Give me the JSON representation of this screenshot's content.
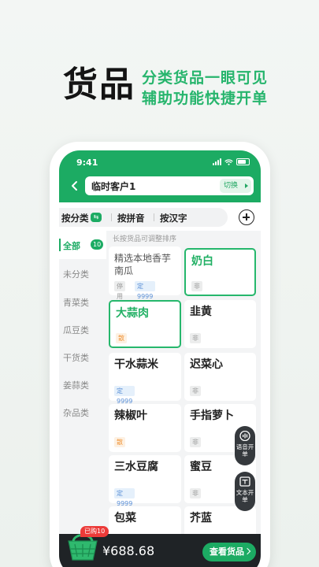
{
  "promo": {
    "title": "货品",
    "subtitle_1": "分类货品一眼可见",
    "subtitle_2": "辅助功能快捷开单",
    "accent": "#27b56d"
  },
  "status": {
    "time": "9:41"
  },
  "header": {
    "customer": "临时客户1",
    "switch_label": "切换",
    "brand": "#1cab63"
  },
  "sort": {
    "options": [
      "按分类",
      "按拼音",
      "按汉字"
    ],
    "swap_icon": "⇆"
  },
  "hint": "长按货品可调整排序",
  "categories": [
    {
      "label": "全部",
      "count": "10"
    },
    {
      "label": "未分类"
    },
    {
      "label": "青菜类"
    },
    {
      "label": "瓜豆类"
    },
    {
      "label": "干货类"
    },
    {
      "label": "姜蒜类"
    },
    {
      "label": "杂品类"
    }
  ],
  "products": [
    {
      "name": "精选本地香芋南瓜",
      "tags": [
        "停用",
        "定9999"
      ]
    },
    {
      "name": "奶白",
      "tags": [
        "非"
      ]
    },
    {
      "name": "大蒜肉",
      "tags": [
        "散"
      ]
    },
    {
      "name": "韭黄",
      "tags": [
        "非"
      ]
    },
    {
      "name": "干水蒜米",
      "tags": [
        "定9999"
      ]
    },
    {
      "name": "迟菜心",
      "tags": [
        "非"
      ]
    },
    {
      "name": "辣椒叶",
      "tags": [
        "散"
      ]
    },
    {
      "name": "手指萝卜",
      "tags": [
        "非"
      ]
    },
    {
      "name": "三水豆腐",
      "tags": [
        "定9999"
      ]
    },
    {
      "name": "蜜豆",
      "tags": [
        "非"
      ]
    },
    {
      "name": "包菜",
      "tags": []
    },
    {
      "name": "芥蓝",
      "tags": []
    }
  ],
  "floating": {
    "voice": "语音开单",
    "text": "文本开单"
  },
  "cart": {
    "purchased": "已购10",
    "total": "¥688.68",
    "view_label": "查看货品"
  }
}
